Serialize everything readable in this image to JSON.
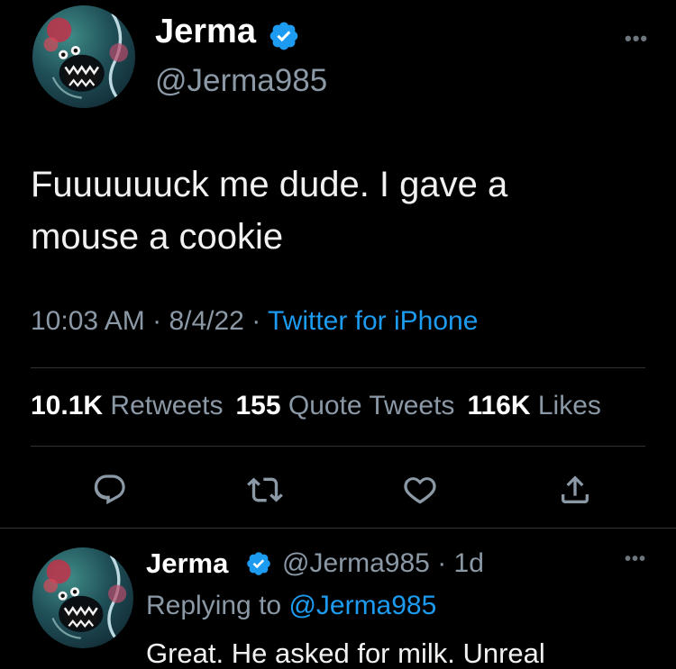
{
  "main_tweet": {
    "display_name": "Jerma",
    "handle": "@Jerma985",
    "more_icon": "more-horizontal-icon",
    "text_line1": "Fuuuuuuck me dude. I gave a",
    "text_line2": "mouse a cookie",
    "time": "10:03 AM",
    "date": "8/4/22",
    "separator": " · ",
    "source": "Twitter for iPhone",
    "stats": {
      "retweets_count": "10.1K",
      "retweets_label": "Retweets",
      "quotes_count": "155",
      "quotes_label": "Quote Tweets",
      "likes_count": "116K",
      "likes_label": "Likes"
    },
    "actions": [
      "reply-icon",
      "retweet-icon",
      "like-icon",
      "share-icon"
    ]
  },
  "reply_tweet": {
    "display_name": "Jerma",
    "handle": "@Jerma985",
    "age": "· 1d",
    "replying_prefix": "Replying to ",
    "replying_to": "@Jerma985",
    "text": "Great. He asked for milk. Unreal"
  },
  "colors": {
    "background": "#000000",
    "accent": "#1d9bf0",
    "muted": "#8b98a5",
    "text": "#e7e9ea"
  }
}
